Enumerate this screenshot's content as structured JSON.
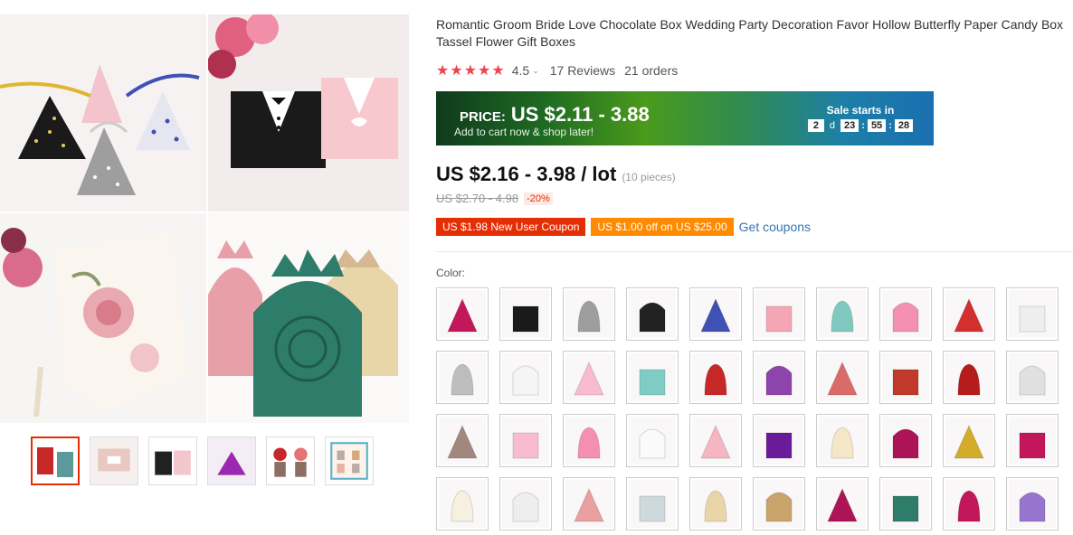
{
  "product": {
    "title": "Romantic Groom Bride Love Chocolate Box Wedding Party Decoration Favor Hollow Butterfly Paper Candy Box Tassel Flower Gift Boxes",
    "rating": "4.5",
    "rating_stars": "★★★★★",
    "rating_chevron": "⌄",
    "reviews": "17 Reviews",
    "orders": "21 orders"
  },
  "sale_banner": {
    "price_label": "PRICE:",
    "price_value": "US $2.11 - 3.88",
    "subtext": "Add to cart now & shop later!",
    "starts_in": "Sale starts in",
    "countdown": {
      "days": "2",
      "days_unit": "d",
      "hours": "23",
      "minutes": "55",
      "seconds": "28",
      "sep": ":"
    }
  },
  "price": {
    "current": "US $2.16 - 3.98 / lot",
    "pieces": "(10 pieces)",
    "original": "US $2.70 - 4.98",
    "discount": "-20%"
  },
  "coupons": {
    "new_user": "US $1.98 New User Coupon",
    "off": "US $1.00 off on US $25.00",
    "get_link": "Get coupons"
  },
  "color": {
    "label": "Color:",
    "swatch_colors": [
      "#c2185b",
      "#1a1a1a",
      "#9e9e9e",
      "#222222",
      "#3f51b5",
      "#f4a6b4",
      "#7fc9c0",
      "#f48fb1",
      "#d32f2f",
      "#eeeeee",
      "#bdbdbd",
      "#f5f5f5",
      "#f8bbd0",
      "#80cbc4",
      "#c62828",
      "#8e44ad",
      "#d96b6b",
      "#c0392b",
      "#b71c1c",
      "#e0e0e0",
      "#a1887f",
      "#f8bbd0",
      "#f48fb1",
      "#fafafa",
      "#f4b6c2",
      "#6a1b9a",
      "#f5e6c8",
      "#ad1457",
      "#d4ac2b",
      "#c2185b",
      "#f5f0e0",
      "#eeeeee",
      "#e8a0a0",
      "#cfd8dc",
      "#e8d5a8",
      "#c9a46a",
      "#ad1457",
      "#2e7d6b",
      "#c2185b",
      "#9575cd"
    ]
  },
  "gallery": {
    "thumb_colors": [
      "#c62828",
      "#fce4ec",
      "#212121",
      "#9c27b0",
      "#8d6e63",
      "#bcaaa4"
    ]
  }
}
